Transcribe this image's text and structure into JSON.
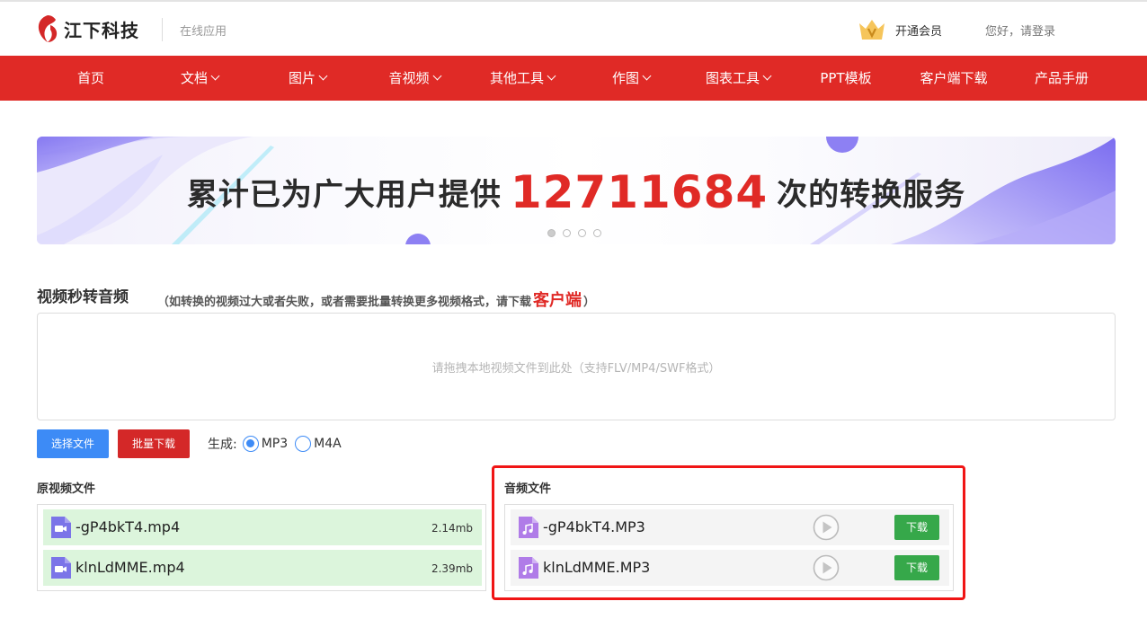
{
  "header": {
    "logo_text": "江下科技",
    "subtitle": "在线应用",
    "vip_label": "开通会员",
    "login_text": "您好，请登录"
  },
  "nav": {
    "items": [
      {
        "label": "首页",
        "dropdown": false
      },
      {
        "label": "文档",
        "dropdown": true
      },
      {
        "label": "图片",
        "dropdown": true
      },
      {
        "label": "音视频",
        "dropdown": true
      },
      {
        "label": "其他工具",
        "dropdown": true
      },
      {
        "label": "作图",
        "dropdown": true
      },
      {
        "label": "图表工具",
        "dropdown": true
      },
      {
        "label": "PPT模板",
        "dropdown": false
      },
      {
        "label": "客户端下载",
        "dropdown": false
      },
      {
        "label": "产品手册",
        "dropdown": false
      }
    ]
  },
  "banner": {
    "text_before": "累计已为广大用户提供",
    "count": "12711684",
    "text_after": "次的转换服务",
    "slides": 4,
    "active_slide": 1
  },
  "tool": {
    "title": "视频秒转音频",
    "note_before": "（如转换的视频过大或者失败，或者需要批量转换更多视频格式，请下载",
    "note_link": "客户端",
    "note_after": "）",
    "dropzone_text": "请拖拽本地视频文件到此处（支持FLV/MP4/SWF格式）",
    "select_button": "选择文件",
    "batch_download_button": "批量下载",
    "generate_label": "生成:",
    "formats": [
      {
        "label": "MP3",
        "selected": true
      },
      {
        "label": "M4A",
        "selected": false
      }
    ]
  },
  "source_files": {
    "title": "原视频文件",
    "items": [
      {
        "name": "-gP4bkT4.mp4",
        "size": "2.14mb"
      },
      {
        "name": "klnLdMME.mp4",
        "size": "2.39mb"
      }
    ]
  },
  "audio_files": {
    "title": "音频文件",
    "download_label": "下载",
    "items": [
      {
        "name": "-gP4bkT4.MP3"
      },
      {
        "name": "klnLdMME.MP3"
      }
    ]
  },
  "colors": {
    "brand_red": "#e02a26",
    "primary_blue": "#3d8bf6",
    "download_green": "#36a84a",
    "highlight_red": "#f01515"
  }
}
